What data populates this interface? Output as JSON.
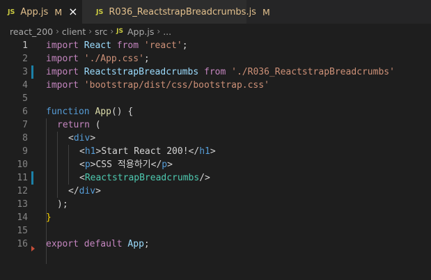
{
  "tabs": [
    {
      "badge": "JS",
      "title": "App.js",
      "status": "M",
      "active": true
    },
    {
      "badge": "JS",
      "title": "R036_ReactstrapBreadcrumbs.js",
      "status": "M",
      "active": false
    }
  ],
  "breadcrumb": {
    "items": [
      "react_200",
      "client",
      "src"
    ],
    "file_badge": "JS",
    "file": "App.js",
    "ellipsis": "...",
    "separator": "›"
  },
  "editor": {
    "line_numbers": [
      "1",
      "2",
      "3",
      "4",
      "5",
      "6",
      "7",
      "8",
      "9",
      "10",
      "11",
      "12",
      "13",
      "14",
      "15",
      "16"
    ],
    "current_line": 1,
    "modified_lines": [
      3,
      11
    ],
    "deleted_marker_after_line": 16,
    "lines": {
      "l1": {
        "import": "import",
        "name": "React",
        "from": "from",
        "source": "'react'",
        "semi": ";"
      },
      "l2": {
        "import": "import",
        "source": "'./App.css'",
        "semi": ";"
      },
      "l3": {
        "import": "import",
        "name": "ReactstrapBreadcrumbs",
        "from": "from",
        "source": "'./R036_ReactstrapBreadcrumbs'"
      },
      "l4": {
        "import": "import",
        "source": "'bootstrap/dist/css/bootstrap.css'"
      },
      "l6": {
        "function": "function",
        "name": "App",
        "parens": "()",
        "brace": "{"
      },
      "l7": {
        "return": "return",
        "paren": "("
      },
      "l8": {
        "open": "<",
        "tag": "div",
        "close": ">"
      },
      "l9": {
        "open": "<",
        "tag": "h1",
        "close": ">",
        "text": "Start React 200!",
        "end_open": "</",
        "end_tag": "h1",
        "end_close": ">"
      },
      "l10": {
        "open": "<",
        "tag": "p",
        "close": ">",
        "text": "CSS 적용하기",
        "end_open": "</",
        "end_tag": "p",
        "end_close": ">"
      },
      "l11": {
        "open": "<",
        "component": "ReactstrapBreadcrumbs",
        "self_close": "/>"
      },
      "l12": {
        "end_open": "</",
        "tag": "div",
        "end_close": ">"
      },
      "l13": {
        "paren": ")",
        "semi": ";"
      },
      "l14": {
        "brace": "}"
      },
      "l16": {
        "export": "export",
        "default": "default",
        "name": "App",
        "semi": ";"
      }
    }
  },
  "colors": {
    "background": "#1e1e1e",
    "tab_bar": "#252526",
    "modified": "#e2c08d",
    "js_badge": "#cbcb41",
    "keyword": "#c586c0",
    "storage": "#569cd6",
    "string": "#ce9178",
    "variable": "#9cdcfe",
    "function": "#dcdcaa",
    "component": "#4ec9b0",
    "bracket": "#ffd700",
    "git_modified": "#1b81a8",
    "git_deleted": "#c74e39"
  }
}
